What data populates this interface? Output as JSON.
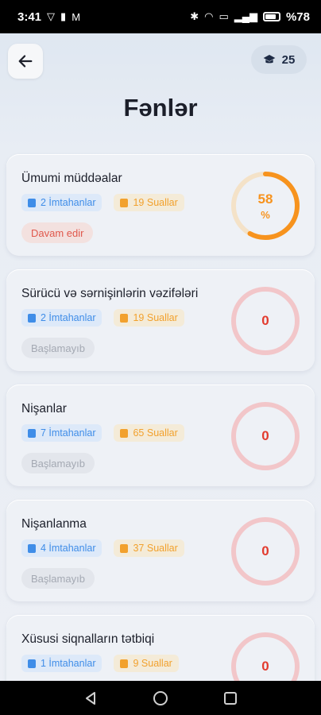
{
  "status_bar": {
    "time": "3:41",
    "battery_text": "%78",
    "left_icons": [
      "vpn-icon",
      "sim-icon",
      "gmail-icon"
    ],
    "right_icons": [
      "bluetooth-icon",
      "wifi-icon",
      "hd-icon",
      "signal-icon",
      "battery-icon"
    ]
  },
  "header": {
    "title": "Fənlər",
    "xp_count": "25",
    "back_icon": "arrow-left-icon",
    "xp_icon": "graduation-cap-icon"
  },
  "colors": {
    "accent_orange": "#f7931e",
    "ring_red": "#f2c6c9",
    "zero_red": "#e23b2e",
    "exam_blue": "#3f8de8",
    "question_orange": "#f2a12d"
  },
  "subjects": [
    {
      "title": "Ümumi müddəalar",
      "exams": "2 İmtahanlar",
      "questions": "19 Suallar",
      "status": "Davam edir",
      "active": true,
      "progress_value": "58",
      "progress_unit": "%",
      "progress_fraction": 0.58
    },
    {
      "title": "Sürücü və sərnişinlərin vəzifələri",
      "exams": "2 İmtahanlar",
      "questions": "19 Suallar",
      "status": "Başlamayıb",
      "active": false,
      "progress_value": "0",
      "progress_unit": "",
      "progress_fraction": 0
    },
    {
      "title": "Nişanlar",
      "exams": "7 İmtahanlar",
      "questions": "65 Suallar",
      "status": "Başlamayıb",
      "active": false,
      "progress_value": "0",
      "progress_unit": "",
      "progress_fraction": 0
    },
    {
      "title": "Nişanlanma",
      "exams": "4 İmtahanlar",
      "questions": "37 Suallar",
      "status": "Başlamayıb",
      "active": false,
      "progress_value": "0",
      "progress_unit": "",
      "progress_fraction": 0
    },
    {
      "title": "Xüsusi siqnalların tətbiqi",
      "exams": "1 İmtahanlar",
      "questions": "9 Suallar",
      "status": "",
      "active": false,
      "progress_value": "0",
      "progress_unit": "",
      "progress_fraction": 0
    }
  ]
}
